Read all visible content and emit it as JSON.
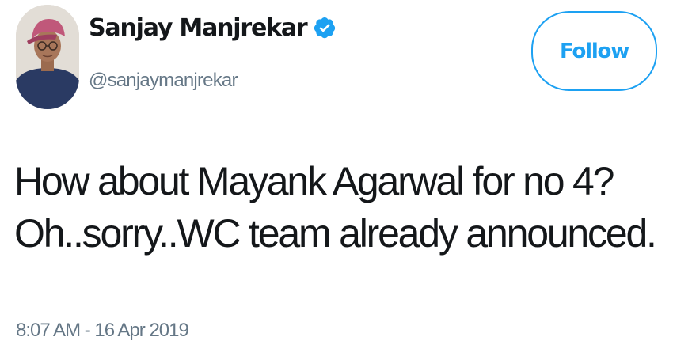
{
  "tweet": {
    "author": {
      "display_name": "Sanjay Manjrekar",
      "handle": "@sanjaymanjrekar",
      "verified": true,
      "avatar": "avatar-photo"
    },
    "follow_button": {
      "label": "Follow"
    },
    "text_lines": [
      "How about Mayank Agarwal for no 4?",
      "Oh..sorry..WC team already announced."
    ],
    "timestamp": "8:07 AM - 16 Apr 2019"
  },
  "colors": {
    "accent": "#1da1f2",
    "text_primary": "#14171a",
    "text_secondary": "#657786",
    "background": "#ffffff"
  },
  "icons": {
    "verified": "verified-badge-icon"
  }
}
